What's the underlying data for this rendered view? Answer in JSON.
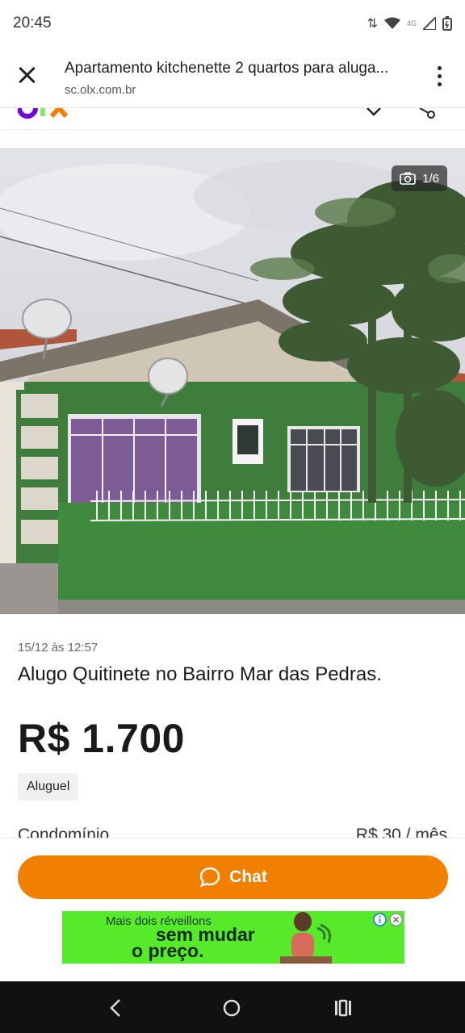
{
  "status_bar": {
    "time": "20:45",
    "network": "4G"
  },
  "browser": {
    "page_title": "Apartamento kitchenette 2 quartos para aluga...",
    "url": "sc.olx.com.br",
    "close_icon": "close-icon",
    "menu_icon": "kebab-menu-icon"
  },
  "photo": {
    "counter": "1/6"
  },
  "listing": {
    "date": "15/12 às 12:57",
    "title": "Alugo Quitinete no Bairro Mar das Pedras.",
    "price": "R$ 1.700",
    "category": "Aluguel",
    "condo_label": "Condomínio",
    "condo_value": "R$ 30 / mês"
  },
  "actions": {
    "chat_label": "Chat"
  },
  "ad": {
    "line1": "Mais dois réveillons",
    "line2": "sem mudar",
    "line3": "o preço."
  },
  "colors": {
    "accent": "#f28000",
    "brand_purple": "#6e0ad6",
    "ad_background": "#57ea2a"
  }
}
